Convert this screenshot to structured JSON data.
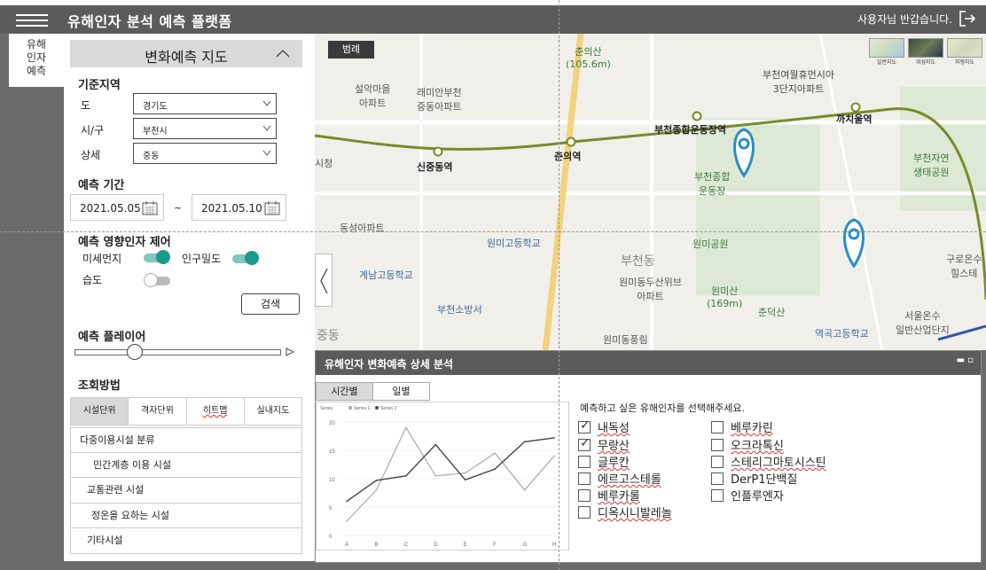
{
  "app": {
    "title": "유해인자 분석 예측 플랫폼",
    "greeting": "사용자님 반갑습니다."
  },
  "rail": {
    "item": "유해\n인자\n예측"
  },
  "panel": {
    "title": "변화예측 지도",
    "region_label": "기준지역",
    "do_label": "도",
    "do_value": "경기도",
    "si_label": "시/구",
    "si_value": "부천시",
    "detail_label": "상세",
    "detail_value": "중동",
    "period_label": "예측 기간",
    "date_from": "2021.05.05",
    "tilde": "~",
    "date_to": "2021.05.10",
    "factor_control_label": "예측 영향인자 제어",
    "toggles": [
      {
        "label": "미세먼지",
        "on": true
      },
      {
        "label": "인구밀도",
        "on": true
      },
      {
        "label": "습도",
        "on": false
      }
    ],
    "search_label": "검색",
    "player_label": "예측 플레이어",
    "player_level": 0.3,
    "view_label": "조회방법",
    "unit_tabs": [
      "시설단위",
      "격자단위",
      "히트맵",
      "실내지도"
    ],
    "active_unit": 0,
    "facilities": [
      "다중이용시설 분류",
      "민간계층 이용 시설",
      "교통관련 시설",
      "정온을 요하는 시설",
      "기타시설"
    ]
  },
  "map": {
    "legend_label": "범례",
    "map_types": [
      "일반지도",
      "위성지도",
      "지형지도"
    ],
    "labels": [
      {
        "text": "춘의산\n(105.6m)"
      },
      {
        "text": "설악마을\n아파트"
      },
      {
        "text": "래미안부천\n중동아파트"
      },
      {
        "text": "부천여월휴먼시아\n3단지아파트"
      },
      {
        "text": "부천종합운동장역"
      },
      {
        "text": "까치울역"
      },
      {
        "text": "신중동역"
      },
      {
        "text": "춘의역"
      },
      {
        "text": "부천종합\n운동장"
      },
      {
        "text": "부천자연\n생태공원"
      },
      {
        "text": "시청"
      },
      {
        "text": "동성아파트"
      },
      {
        "text": "원미고등학교"
      },
      {
        "text": "원미공원"
      },
      {
        "text": "계남고등학교"
      },
      {
        "text": "부천동"
      },
      {
        "text": "원미동두산위브\n아파트"
      },
      {
        "text": "원미산\n(169m)"
      },
      {
        "text": "춘덕산"
      },
      {
        "text": "부천소방서"
      },
      {
        "text": "중동"
      },
      {
        "text": "원미동풍림"
      },
      {
        "text": "역곡고등학교"
      },
      {
        "text": "서울온수\n일반산업단지"
      },
      {
        "text": "구로온수\n힐스테"
      }
    ]
  },
  "detail": {
    "title": "유해인자 변화예측 상세 분석",
    "tabs": [
      "시간별",
      "일별"
    ],
    "active_tab": 0,
    "prompt": "예측하고 싶은 유해인자를 선택해주세요.",
    "factors": [
      {
        "label": "내독성",
        "checked": true,
        "wavy": true
      },
      {
        "label": "무랑산",
        "checked": true,
        "wavy": true
      },
      {
        "label": "글루칸",
        "checked": false,
        "wavy": true
      },
      {
        "label": "에르고스테롤",
        "checked": false,
        "wavy": true
      },
      {
        "label": "베루카롤",
        "checked": false,
        "wavy": true
      },
      {
        "label": "디옥시니발레놀",
        "checked": false,
        "wavy": true
      },
      {
        "label": "베루카린",
        "checked": false,
        "wavy": true
      },
      {
        "label": "오크라톡신",
        "checked": false,
        "wavy": true
      },
      {
        "label": "스테리그마토시스틴",
        "checked": false,
        "wavy": true
      },
      {
        "label": "DerP1단백질",
        "checked": false,
        "wavy": false
      },
      {
        "label": "인플루엔자",
        "checked": false,
        "wavy": false
      }
    ]
  },
  "colors": {
    "header": "#5b5b5b",
    "toggle_on": "#1b9b8a",
    "marker": "#2a8fc4",
    "rail_line": "#7a8a2a",
    "road": "#f2d27a"
  },
  "chart_data": {
    "type": "line",
    "title": "Series",
    "categories": [
      "A",
      "B",
      "C",
      "D",
      "E",
      "F",
      "G",
      "H"
    ],
    "series": [
      {
        "name": "Series 1",
        "values": [
          2.5,
          8,
          19,
          10.5,
          11,
          14.5,
          8,
          14
        ]
      },
      {
        "name": "Series 2",
        "values": [
          6,
          9.7,
          10.5,
          16,
          9.8,
          11.7,
          16.5,
          17.2
        ]
      }
    ],
    "ylim": [
      0,
      20
    ],
    "yticks": [
      0,
      5,
      10,
      15,
      20
    ],
    "legend": "top-left"
  }
}
